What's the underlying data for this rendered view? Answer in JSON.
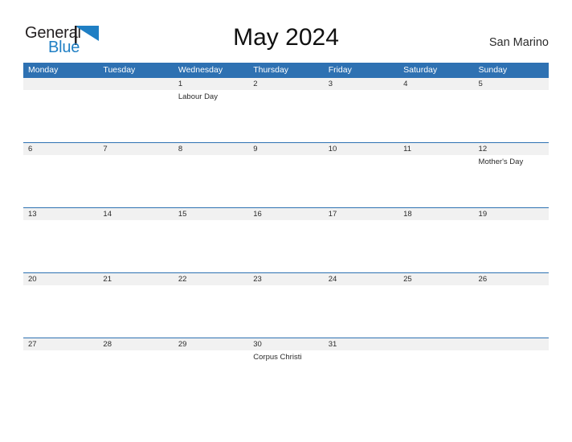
{
  "brand": {
    "name_part1": "General",
    "name_part2": "Blue",
    "mark_icon": "blue-flag-triangle-icon",
    "color_dark": "#231f20",
    "color_blue": "#1f7fc4"
  },
  "header": {
    "title": "May 2024",
    "location": "San Marino"
  },
  "theme": {
    "header_blue": "#2E71B2",
    "date_strip_gray": "#F1F1F1",
    "text_dark": "#2B2B2B",
    "page_background": "#FFFFFF"
  },
  "calendar": {
    "month": "May",
    "year": "2024",
    "weekdays": [
      "Monday",
      "Tuesday",
      "Wednesday",
      "Thursday",
      "Friday",
      "Saturday",
      "Sunday"
    ],
    "weeks": [
      {
        "dates": [
          "",
          "",
          "1",
          "2",
          "3",
          "4",
          "5"
        ],
        "events": [
          "",
          "",
          "Labour Day",
          "",
          "",
          "",
          ""
        ]
      },
      {
        "dates": [
          "6",
          "7",
          "8",
          "9",
          "10",
          "11",
          "12"
        ],
        "events": [
          "",
          "",
          "",
          "",
          "",
          "",
          "Mother's Day"
        ]
      },
      {
        "dates": [
          "13",
          "14",
          "15",
          "16",
          "17",
          "18",
          "19"
        ],
        "events": [
          "",
          "",
          "",
          "",
          "",
          "",
          ""
        ]
      },
      {
        "dates": [
          "20",
          "21",
          "22",
          "23",
          "24",
          "25",
          "26"
        ],
        "events": [
          "",
          "",
          "",
          "",
          "",
          "",
          ""
        ]
      },
      {
        "dates": [
          "27",
          "28",
          "29",
          "30",
          "31",
          "",
          ""
        ],
        "events": [
          "",
          "",
          "",
          "Corpus Christi",
          "",
          "",
          ""
        ]
      }
    ]
  }
}
